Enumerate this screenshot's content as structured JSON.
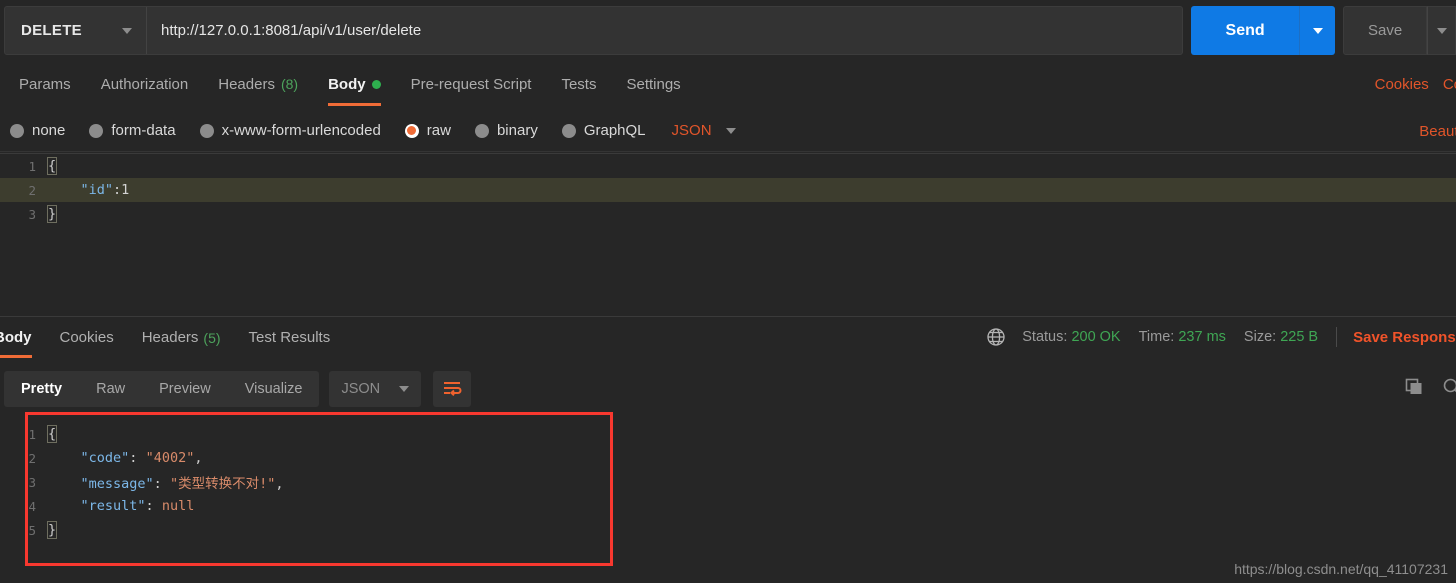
{
  "request": {
    "method": "DELETE",
    "url": "http://127.0.0.1:8081/api/v1/user/delete",
    "send_label": "Send",
    "save_label": "Save",
    "tabs": [
      {
        "label": "Params",
        "count": "",
        "active": false,
        "dot": false
      },
      {
        "label": "Authorization",
        "count": "",
        "active": false,
        "dot": false
      },
      {
        "label": "Headers",
        "count": "(8)",
        "active": false,
        "dot": false
      },
      {
        "label": "Body",
        "count": "",
        "active": true,
        "dot": true
      },
      {
        "label": "Pre-request Script",
        "count": "",
        "active": false,
        "dot": false
      },
      {
        "label": "Tests",
        "count": "",
        "active": false,
        "dot": false
      },
      {
        "label": "Settings",
        "count": "",
        "active": false,
        "dot": false
      }
    ],
    "right_links": [
      "Cookies",
      "Co"
    ],
    "body_types": [
      {
        "label": "none",
        "selected": false
      },
      {
        "label": "form-data",
        "selected": false
      },
      {
        "label": "x-www-form-urlencoded",
        "selected": false
      },
      {
        "label": "raw",
        "selected": true
      },
      {
        "label": "binary",
        "selected": false
      },
      {
        "label": "GraphQL",
        "selected": false
      }
    ],
    "raw_format": "JSON",
    "beautify_label": "Beautif",
    "editor_lines": [
      {
        "num": "1",
        "highlight": false,
        "tokens": [
          {
            "t": "{",
            "cls": "tok-punc brace-box"
          }
        ]
      },
      {
        "num": "2",
        "highlight": true,
        "tokens": [
          {
            "t": "    ",
            "cls": "tok-punc"
          },
          {
            "t": "\"id\"",
            "cls": "tok-key"
          },
          {
            "t": ":",
            "cls": "tok-punc"
          },
          {
            "t": "1",
            "cls": "tok-num"
          }
        ]
      },
      {
        "num": "3",
        "highlight": false,
        "tokens": [
          {
            "t": "}",
            "cls": "tok-punc brace-box"
          }
        ]
      }
    ]
  },
  "response": {
    "tabs": [
      {
        "label": "Body",
        "count": "",
        "active": true
      },
      {
        "label": "Cookies",
        "count": "",
        "active": false
      },
      {
        "label": "Headers",
        "count": "(5)",
        "active": false
      },
      {
        "label": "Test Results",
        "count": "",
        "active": false
      }
    ],
    "status_label": "Status:",
    "status_value": "200 OK",
    "time_label": "Time:",
    "time_value": "237 ms",
    "size_label": "Size:",
    "size_value": "225 B",
    "save_response_label": "Save Response",
    "view_modes": [
      {
        "label": "Pretty",
        "active": true
      },
      {
        "label": "Raw",
        "active": false
      },
      {
        "label": "Preview",
        "active": false
      },
      {
        "label": "Visualize",
        "active": false
      }
    ],
    "format": "JSON",
    "body_lines": [
      {
        "num": "1",
        "tokens": [
          {
            "t": "{",
            "cls": "tok-punc brace-box"
          }
        ]
      },
      {
        "num": "2",
        "tokens": [
          {
            "t": "    ",
            "cls": "tok-punc"
          },
          {
            "t": "\"code\"",
            "cls": "tok-key"
          },
          {
            "t": ": ",
            "cls": "tok-punc"
          },
          {
            "t": "\"4002\"",
            "cls": "tok-str"
          },
          {
            "t": ",",
            "cls": "tok-punc"
          }
        ]
      },
      {
        "num": "3",
        "tokens": [
          {
            "t": "    ",
            "cls": "tok-punc"
          },
          {
            "t": "\"message\"",
            "cls": "tok-key"
          },
          {
            "t": ": ",
            "cls": "tok-punc"
          },
          {
            "t": "\"类型转换不对!\"",
            "cls": "tok-str"
          },
          {
            "t": ",",
            "cls": "tok-punc"
          }
        ]
      },
      {
        "num": "4",
        "tokens": [
          {
            "t": "    ",
            "cls": "tok-punc"
          },
          {
            "t": "\"result\"",
            "cls": "tok-key"
          },
          {
            "t": ": ",
            "cls": "tok-punc"
          },
          {
            "t": "null",
            "cls": "tok-str"
          }
        ]
      },
      {
        "num": "5",
        "tokens": [
          {
            "t": "}",
            "cls": "tok-punc brace-box"
          }
        ]
      }
    ]
  },
  "watermark": "https://blog.csdn.net/qq_41107231",
  "colors": {
    "accent_orange": "#f06c37",
    "link_orange": "#e1552a",
    "send_blue": "#0f7ae5",
    "status_green": "#3fa654",
    "annotation_red": "#f8382f",
    "json_key": "#7cb7e8",
    "json_string": "#d98b6a",
    "highlight_line": "#3d3d2e"
  }
}
